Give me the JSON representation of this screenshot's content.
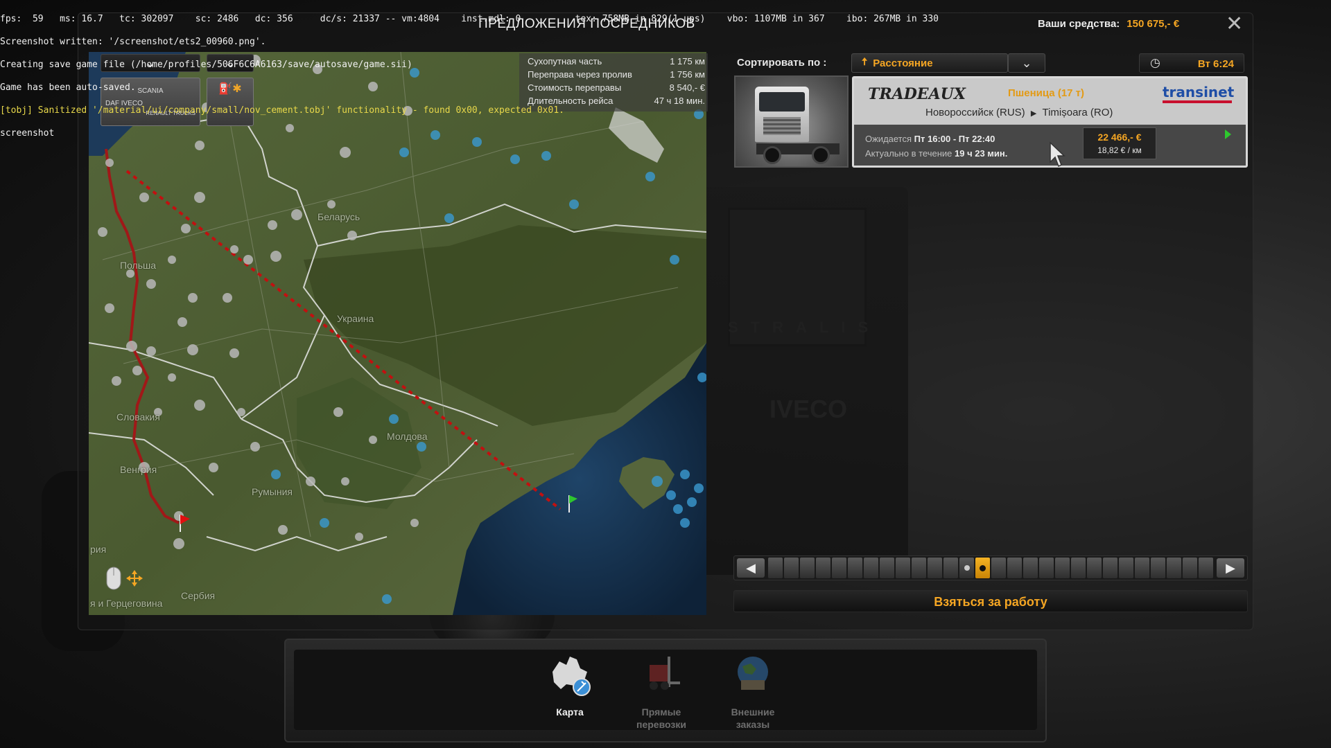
{
  "console": [
    "fps:  59   ms: 16.7   tc: 302097    sc: 2486   dc: 356     dc/s: 21337 -- vm:4804    inst.mdl: 0          tex: 758MB in 829(1 ups)    vbo: 1107MB in 367    ibo: 267MB in 330",
    "Screenshot written: '/screenshot/ets2_00960.png'.",
    "Creating save game file (/home/profiles/506F6C6A6163/save/autosave/game.sii)",
    "Game has been auto-saved.",
    "[tobj] Sanitized '/material/ui/company/small/nov_cement.tobj' functionality - found 0x00, expected 0x01.",
    "screenshot"
  ],
  "window": {
    "title": "ПРЕДЛОЖЕНИЯ ПОСРЕДНИКОВ",
    "funds_label": "Ваши средства:",
    "funds_value": "150 675,- €"
  },
  "map": {
    "labels": {
      "belarus": "Беларусь",
      "poland": "Польша",
      "ukraine": "Украина",
      "slovakia": "Словакия",
      "hungary": "Венгрия",
      "moldova": "Молдова",
      "romania": "Румыния",
      "serbia": "Сербия",
      "bosnia": "я и Герцеговина",
      "austria": "рия"
    },
    "brand_box_text": [
      "SCANIA",
      "DAF IVECO",
      "RENAULT TRUCKS"
    ],
    "route_stats": [
      {
        "label": "Сухопутная часть",
        "value": "1 175 км"
      },
      {
        "label": "Переправа через пролив",
        "value": "1 756 км"
      },
      {
        "label": "Стоимость переправы",
        "value": "8 540,- €"
      },
      {
        "label": "Длительность рейса",
        "value": "47 ч 18 мин."
      }
    ]
  },
  "sort": {
    "label": "Сортировать по :",
    "value": "Расстояние",
    "game_time": "Вт 6:24"
  },
  "offer": {
    "company_from_logo": "TRADEAUX",
    "company_to_logo": "transinet",
    "cargo": "Пшеница (17 т)",
    "origin": "Новороссийск (RUS)",
    "destination": "Timișoara (RO)",
    "expected_label": "Ожидается",
    "expected_value": "Пт 16:00 - Пт 22:40",
    "valid_label": "Актуально в течение",
    "valid_value": "19 ч 23 мин.",
    "price": "22 466,- €",
    "per_km": "18,82 € / км"
  },
  "pager": {
    "total_pages": 28,
    "current_page": 14,
    "dot_page": 13
  },
  "take_job_label": "Взяться за работу",
  "nav": [
    {
      "label": "Карта",
      "active": true
    },
    {
      "label": "Прямые перевозки",
      "active": false
    },
    {
      "label": "Внешние заказы",
      "active": false
    }
  ]
}
